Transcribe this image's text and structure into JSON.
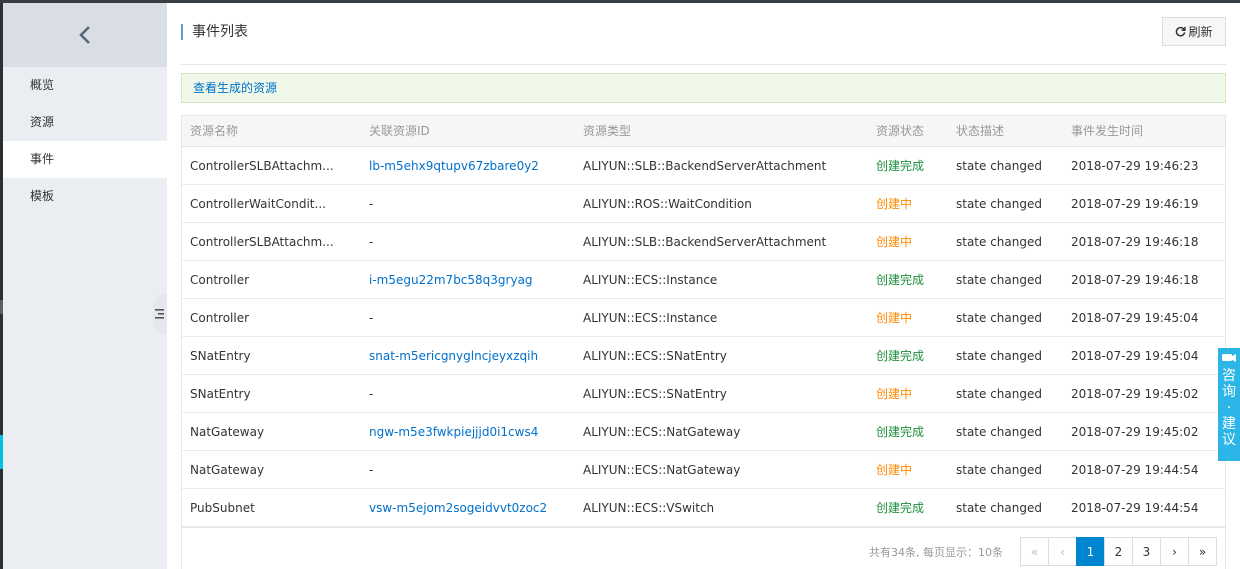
{
  "sidebar": {
    "items": [
      {
        "label": "概览",
        "active": false
      },
      {
        "label": "资源",
        "active": false
      },
      {
        "label": "事件",
        "active": true
      },
      {
        "label": "模板",
        "active": false
      }
    ]
  },
  "header": {
    "title": "事件列表",
    "refresh_label": "刷新"
  },
  "notice": {
    "link_text": "查看生成的资源"
  },
  "table": {
    "columns": [
      "资源名称",
      "关联资源ID",
      "资源类型",
      "资源状态",
      "状态描述",
      "事件发生时间"
    ],
    "rows": [
      {
        "name": "ControllerSLBAttachm...",
        "id": "lb-m5ehx9qtupv67zbare0y2",
        "type": "ALIYUN::SLB::BackendServerAttachment",
        "status": "创建完成",
        "status_kind": "ok",
        "desc": "state changed",
        "time": "2018-07-29 19:46:23"
      },
      {
        "name": "ControllerWaitCondit...",
        "id": "-",
        "type": "ALIYUN::ROS::WaitCondition",
        "status": "创建中",
        "status_kind": "pending",
        "desc": "state changed",
        "time": "2018-07-29 19:46:19"
      },
      {
        "name": "ControllerSLBAttachm...",
        "id": "-",
        "type": "ALIYUN::SLB::BackendServerAttachment",
        "status": "创建中",
        "status_kind": "pending",
        "desc": "state changed",
        "time": "2018-07-29 19:46:18"
      },
      {
        "name": "Controller",
        "id": "i-m5egu22m7bc58q3gryag",
        "type": "ALIYUN::ECS::Instance",
        "status": "创建完成",
        "status_kind": "ok",
        "desc": "state changed",
        "time": "2018-07-29 19:46:18"
      },
      {
        "name": "Controller",
        "id": "-",
        "type": "ALIYUN::ECS::Instance",
        "status": "创建中",
        "status_kind": "pending",
        "desc": "state changed",
        "time": "2018-07-29 19:45:04"
      },
      {
        "name": "SNatEntry",
        "id": "snat-m5ericgnyglncjeyxzqih",
        "type": "ALIYUN::ECS::SNatEntry",
        "status": "创建完成",
        "status_kind": "ok",
        "desc": "state changed",
        "time": "2018-07-29 19:45:04"
      },
      {
        "name": "SNatEntry",
        "id": "-",
        "type": "ALIYUN::ECS::SNatEntry",
        "status": "创建中",
        "status_kind": "pending",
        "desc": "state changed",
        "time": "2018-07-29 19:45:02"
      },
      {
        "name": "NatGateway",
        "id": "ngw-m5e3fwkpiejjjd0i1cws4",
        "type": "ALIYUN::ECS::NatGateway",
        "status": "创建完成",
        "status_kind": "ok",
        "desc": "state changed",
        "time": "2018-07-29 19:45:02"
      },
      {
        "name": "NatGateway",
        "id": "-",
        "type": "ALIYUN::ECS::NatGateway",
        "status": "创建中",
        "status_kind": "pending",
        "desc": "state changed",
        "time": "2018-07-29 19:44:54"
      },
      {
        "name": "PubSubnet",
        "id": "vsw-m5ejom2sogeidvvt0zoc2",
        "type": "ALIYUN::ECS::VSwitch",
        "status": "创建完成",
        "status_kind": "ok",
        "desc": "state changed",
        "time": "2018-07-29 19:44:54"
      }
    ]
  },
  "pagination": {
    "summary": "共有34条, 每页显示：10条",
    "first": "«",
    "prev": "‹",
    "pages": [
      "1",
      "2",
      "3"
    ],
    "current": "1",
    "next": "›",
    "last": "»"
  },
  "consult": {
    "label": "咨询·建议"
  },
  "colors": {
    "ok": "#1e8e3e",
    "pending": "#ff8a00",
    "link": "#0070cc",
    "accent": "#0085d0"
  },
  "icons": {
    "back": "chevron-left-icon",
    "refresh": "refresh-icon",
    "menu_toggle": "list-toggle-icon",
    "consult": "chat-icon"
  }
}
